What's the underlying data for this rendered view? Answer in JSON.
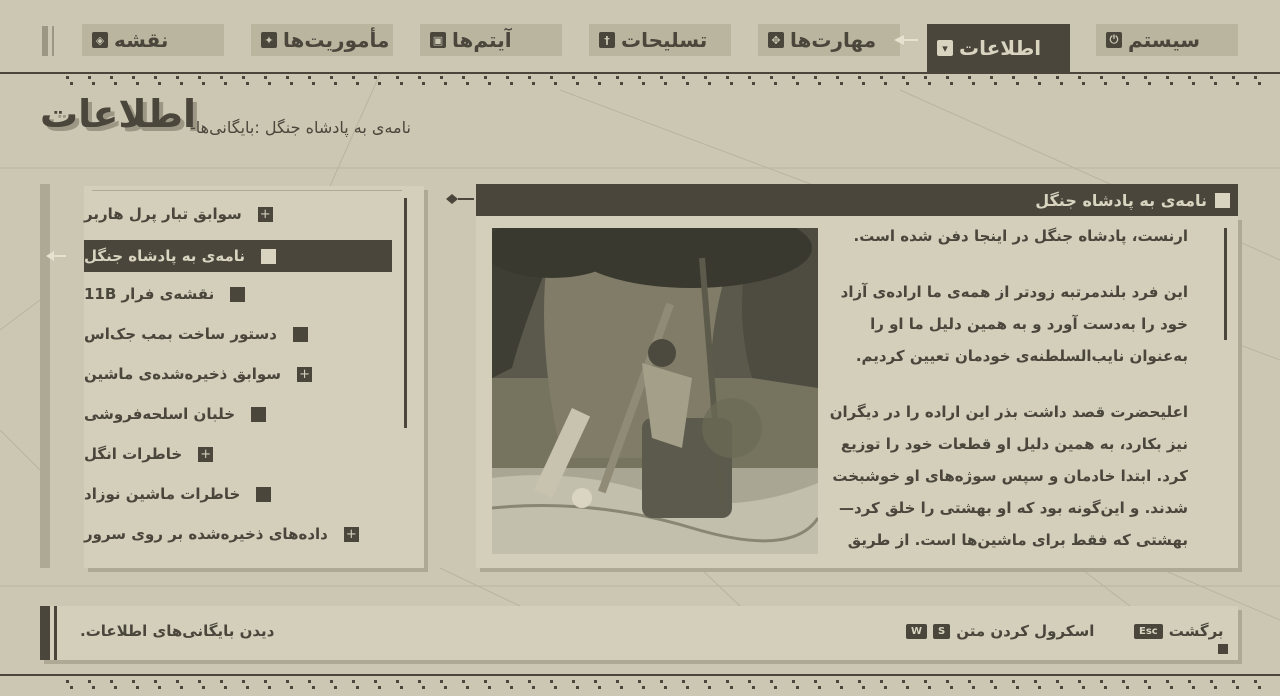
{
  "nav": {
    "tabs": [
      {
        "label": "سیستم",
        "icon": "power-icon"
      },
      {
        "label": "اطلاعات",
        "icon": "data-icon",
        "active": true
      },
      {
        "label": "مهارت‌ها",
        "icon": "skills-icon"
      },
      {
        "label": "تسلیحات",
        "icon": "weapons-icon"
      },
      {
        "label": "آیتم‌ها",
        "icon": "items-icon"
      },
      {
        "label": "مأموریت‌ها",
        "icon": "quests-icon"
      },
      {
        "label": "نقشه",
        "icon": "map-icon"
      }
    ]
  },
  "header": {
    "title": "اطلاعات",
    "breadcrumb": "نامه‌ی به پادشاه جنگل :بایگانی‌ها-"
  },
  "archive_list": {
    "items": [
      {
        "label": "سوابق تبار پرل هاربر",
        "marker": "+"
      },
      {
        "label": "نامه‌ی به پادشاه جنگل",
        "marker": "",
        "selected": true
      },
      {
        "label": "نقشه‌ی فرار 11B",
        "marker": ""
      },
      {
        "label": "دستور ساخت بمب جک‌اس",
        "marker": ""
      },
      {
        "label": "سوابق ذخیره‌شده‌ی ماشین",
        "marker": "+"
      },
      {
        "label": "خلبان اسلحه‌فروشی",
        "marker": ""
      },
      {
        "label": "خاطرات انگل",
        "marker": "+"
      },
      {
        "label": "خاطرات ماشین نوزاد",
        "marker": ""
      },
      {
        "label": "داده‌های ذخیره‌شده بر روی سرور",
        "marker": "+"
      }
    ]
  },
  "content": {
    "title": "نامه‌ی به پادشاه جنگل",
    "paragraphs": [
      "ارنست، پادشاه جنگل در اینجا دفن شده است.",
      "این فرد بلندمرتبه زودتر از همه‌ی ما اراده‌ی آزاد خود را به‌دست آورد و به همین دلیل ما او را به‌عنوان نایب‌السلطنه‌ی خودمان تعیین کردیم.",
      "اعلیحضرت قصد داشت بذر این اراده را در دیگران نیز بکارد، به همین دلیل او قطعات خود را توزیع کرد. ابتدا خادمان و سپس سوژه‌های او خوشبخت شدند. و این‌گونه بود که او بهشتی را خلق کرد—بهشتی که فقط برای ماشین‌ها است. از طریق هدایای او بود که ما درباره‌ی مفهومی"
    ]
  },
  "footer": {
    "hint": "دیدن بایگانی‌های اطلاعات.",
    "back_label": "برگشت",
    "back_key": "Esc",
    "scroll_label": "اسکرول کردن متن",
    "scroll_key_1": "S",
    "scroll_key_2": "W"
  },
  "colors": {
    "background": "#cbc7b2",
    "panel": "#d3cfbb",
    "dark": "#4a463c",
    "tab": "#bab59f"
  }
}
